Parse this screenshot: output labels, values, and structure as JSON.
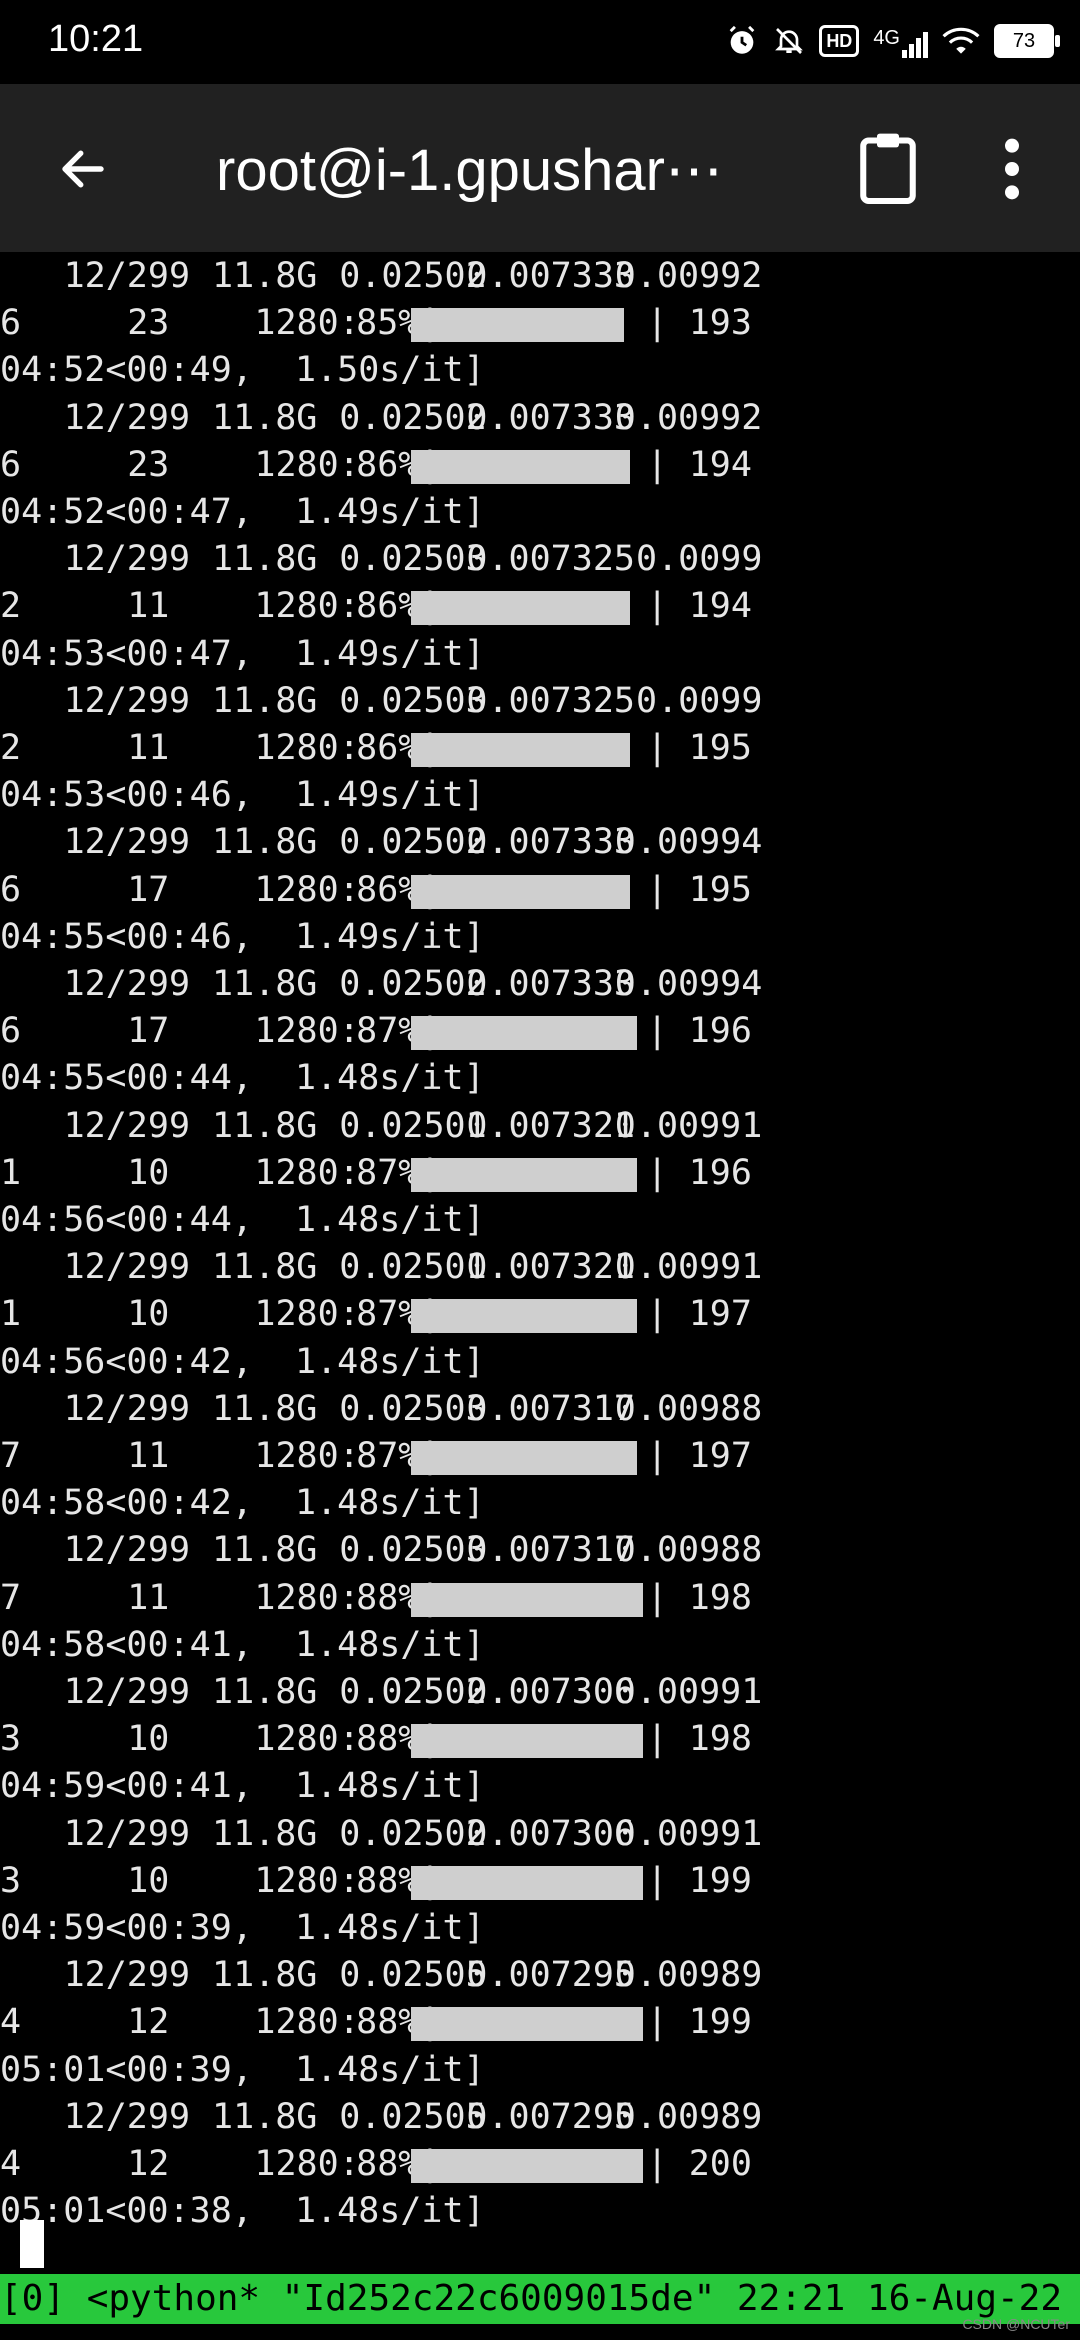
{
  "status_bar": {
    "time": "10:21",
    "network": "4G",
    "hd": "HD",
    "battery": "73",
    "icons": [
      "alarm-icon",
      "mute-icon",
      "hd-icon",
      "signal-icon",
      "wifi-icon",
      "battery-icon"
    ]
  },
  "app_bar": {
    "title": "root@i-1.gpushar⋯",
    "icons": [
      "back-arrow-icon",
      "clipboard-icon",
      "more-vert-icon"
    ]
  },
  "terminal": {
    "rows": [
      {
        "epoch": "12/299",
        "mem": "11.8G",
        "box": "0.02502",
        "obj": "0.007333",
        "cls_a": "0.00992",
        "cls_b": "6",
        "inst": "23",
        "size": "1280:",
        "pct": "85%|",
        "progress": 0.85,
        "count": "| 193",
        "timing": "04:52<00:49,  1.50s/it]"
      },
      {
        "epoch": "12/299",
        "mem": "11.8G",
        "box": "0.02502",
        "obj": "0.007333",
        "cls_a": "0.00992",
        "cls_b": "6",
        "inst": "23",
        "size": "1280:",
        "pct": "86%|",
        "progress": 0.86,
        "count": "| 194",
        "timing": "04:52<00:47,  1.49s/it]"
      },
      {
        "epoch": "12/299",
        "mem": "11.8G",
        "box": "0.02503",
        "obj": "0.007325",
        "cls_a": "0.0099",
        "cls_b": "2",
        "inst": "11",
        "size": "1280:",
        "pct": "86%|",
        "progress": 0.86,
        "count": "| 194",
        "timing": "04:53<00:47,  1.49s/it]"
      },
      {
        "epoch": "12/299",
        "mem": "11.8G",
        "box": "0.02503",
        "obj": "0.007325",
        "cls_a": "0.0099",
        "cls_b": "2",
        "inst": "11",
        "size": "1280:",
        "pct": "86%|",
        "progress": 0.86,
        "count": "| 195",
        "timing": "04:53<00:46,  1.49s/it]"
      },
      {
        "epoch": "12/299",
        "mem": "11.8G",
        "box": "0.02502",
        "obj": "0.007333",
        "cls_a": "0.00994",
        "cls_b": "6",
        "inst": "17",
        "size": "1280:",
        "pct": "86%|",
        "progress": 0.86,
        "count": "| 195",
        "timing": "04:55<00:46,  1.49s/it]"
      },
      {
        "epoch": "12/299",
        "mem": "11.8G",
        "box": "0.02502",
        "obj": "0.007333",
        "cls_a": "0.00994",
        "cls_b": "6",
        "inst": "17",
        "size": "1280:",
        "pct": "87%|",
        "progress": 0.87,
        "count": "| 196",
        "timing": "04:55<00:44,  1.48s/it]"
      },
      {
        "epoch": "12/299",
        "mem": "11.8G",
        "box": "0.02501",
        "obj": "0.007321",
        "cls_a": "0.00991",
        "cls_b": "1",
        "inst": "10",
        "size": "1280:",
        "pct": "87%|",
        "progress": 0.87,
        "count": "| 196",
        "timing": "04:56<00:44,  1.48s/it]"
      },
      {
        "epoch": "12/299",
        "mem": "11.8G",
        "box": "0.02501",
        "obj": "0.007321",
        "cls_a": "0.00991",
        "cls_b": "1",
        "inst": "10",
        "size": "1280:",
        "pct": "87%|",
        "progress": 0.87,
        "count": "| 197",
        "timing": "04:56<00:42,  1.48s/it]"
      },
      {
        "epoch": "12/299",
        "mem": "11.8G",
        "box": "0.02503",
        "obj": "0.007317",
        "cls_a": "0.00988",
        "cls_b": "7",
        "inst": "11",
        "size": "1280:",
        "pct": "87%|",
        "progress": 0.87,
        "count": "| 197",
        "timing": "04:58<00:42,  1.48s/it]"
      },
      {
        "epoch": "12/299",
        "mem": "11.8G",
        "box": "0.02503",
        "obj": "0.007317",
        "cls_a": "0.00988",
        "cls_b": "7",
        "inst": "11",
        "size": "1280:",
        "pct": "88%|",
        "progress": 0.88,
        "count": "| 198",
        "timing": "04:58<00:41,  1.48s/it]"
      },
      {
        "epoch": "12/299",
        "mem": "11.8G",
        "box": "0.02502",
        "obj": "0.007306",
        "cls_a": "0.00991",
        "cls_b": "3",
        "inst": "10",
        "size": "1280:",
        "pct": "88%|",
        "progress": 0.88,
        "count": "| 198",
        "timing": "04:59<00:41,  1.48s/it]"
      },
      {
        "epoch": "12/299",
        "mem": "11.8G",
        "box": "0.02502",
        "obj": "0.007306",
        "cls_a": "0.00991",
        "cls_b": "3",
        "inst": "10",
        "size": "1280:",
        "pct": "88%|",
        "progress": 0.88,
        "count": "| 199",
        "timing": "04:59<00:39,  1.48s/it]"
      },
      {
        "epoch": "12/299",
        "mem": "11.8G",
        "box": "0.02505",
        "obj": "0.007295",
        "cls_a": "0.00989",
        "cls_b": "4",
        "inst": "12",
        "size": "1280:",
        "pct": "88%|",
        "progress": 0.88,
        "count": "| 199",
        "timing": "05:01<00:39,  1.48s/it]"
      },
      {
        "epoch": "12/299",
        "mem": "11.8G",
        "box": "0.02505",
        "obj": "0.007295",
        "cls_a": "0.00989",
        "cls_b": "4",
        "inst": "12",
        "size": "1280:",
        "pct": "88%|",
        "progress": 0.88,
        "count": "| 200",
        "timing": "05:01<00:38,  1.48s/it]"
      }
    ]
  },
  "tmux": {
    "text": "[0] <python* \"Id252c22c6009015de\" 22:21 16-Aug-22",
    "color": "#28c83c"
  },
  "watermark": "CSDN @NCUTer"
}
